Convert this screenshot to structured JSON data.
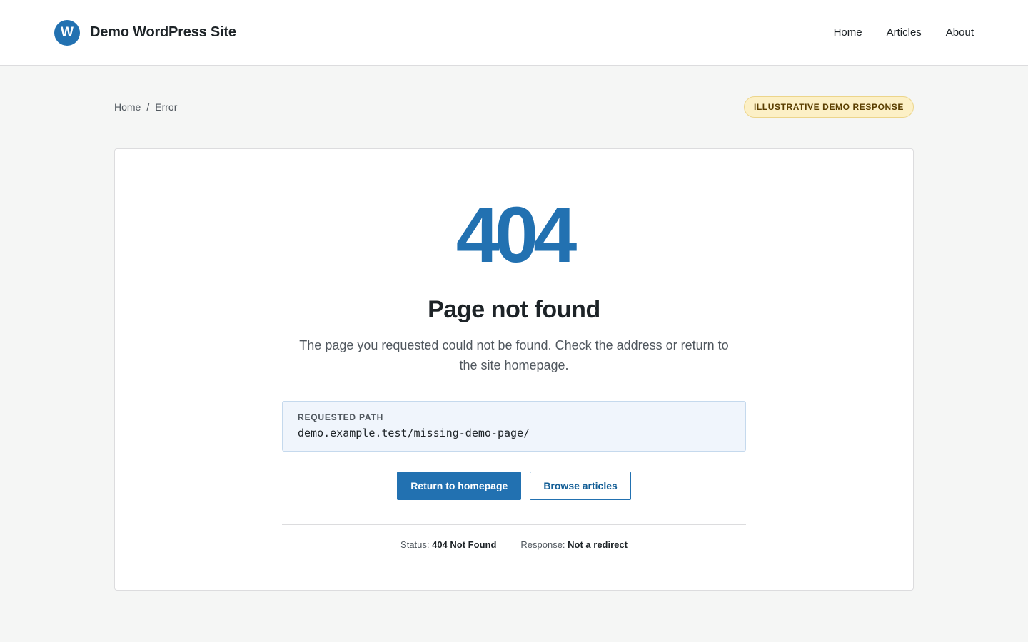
{
  "header": {
    "logo_letter": "W",
    "site_title": "Demo WordPress Site",
    "nav": [
      {
        "label": "Home"
      },
      {
        "label": "Articles"
      },
      {
        "label": "About"
      }
    ]
  },
  "breadcrumb": {
    "home": "Home",
    "separator": "/",
    "current": "Error"
  },
  "badge": "ILLUSTRATIVE DEMO RESPONSE",
  "error": {
    "code": "404",
    "title": "Page not found",
    "message": "The page you requested could not be found. Check the address or return to the site homepage.",
    "path_label": "REQUESTED PATH",
    "path_value": "demo.example.test/missing-demo-page/",
    "primary_button": "Return to homepage",
    "secondary_button": "Browse articles",
    "status_label": "Status:",
    "status_value": "404 Not Found",
    "response_label": "Response:",
    "response_value": "Not a redirect"
  },
  "colors": {
    "accent": "#2271b1",
    "badge_bg": "#fcf0c6",
    "path_bg": "#f0f5fc"
  }
}
